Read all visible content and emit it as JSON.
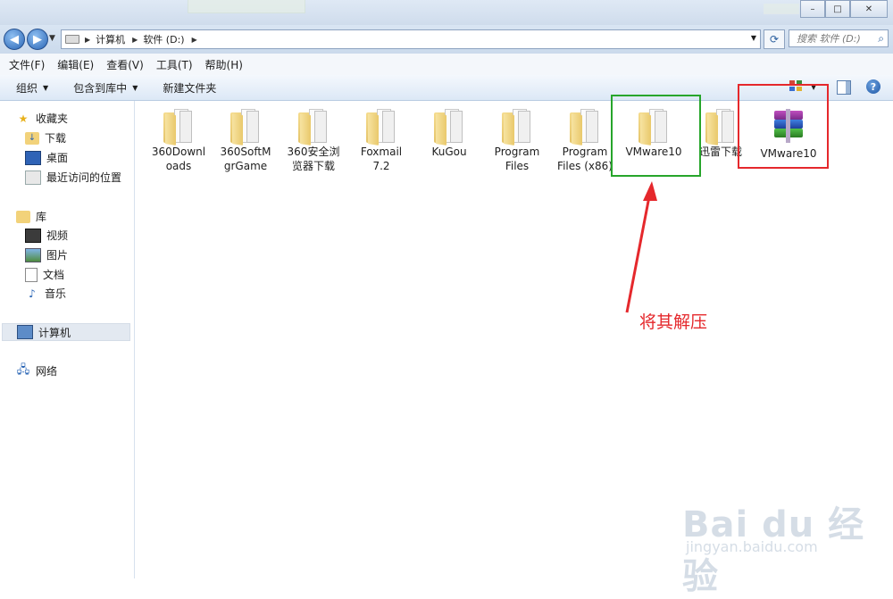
{
  "window": {
    "buttons": {
      "minimize": "–",
      "maximize": "□",
      "close": "✕"
    }
  },
  "address": {
    "segments": [
      "计算机",
      "软件 (D:)"
    ],
    "search_placeholder": "搜索 软件 (D:)"
  },
  "menu": [
    "文件(F)",
    "编辑(E)",
    "查看(V)",
    "工具(T)",
    "帮助(H)"
  ],
  "toolbar": {
    "organize": "组织",
    "include_in_library": "包含到库中",
    "new_folder": "新建文件夹"
  },
  "sidebar": {
    "favorites": {
      "label": "收藏夹",
      "icon": "star-icon",
      "items": [
        {
          "label": "下载",
          "icon": "download-folder-icon"
        },
        {
          "label": "桌面",
          "icon": "desktop-icon"
        },
        {
          "label": "最近访问的位置",
          "icon": "recent-places-icon"
        }
      ]
    },
    "libraries": {
      "label": "库",
      "icon": "library-icon",
      "items": [
        {
          "label": "视频",
          "icon": "video-icon"
        },
        {
          "label": "图片",
          "icon": "pictures-icon"
        },
        {
          "label": "文档",
          "icon": "documents-icon"
        },
        {
          "label": "音乐",
          "icon": "music-icon"
        }
      ]
    },
    "computer": {
      "label": "计算机",
      "icon": "computer-icon"
    },
    "network": {
      "label": "网络",
      "icon": "network-icon"
    }
  },
  "files": [
    {
      "name": "360Downloads",
      "lines": [
        "360Downl",
        "oads"
      ],
      "type": "folder"
    },
    {
      "name": "360SoftMgrGame",
      "lines": [
        "360SoftM",
        "grGame"
      ],
      "type": "folder"
    },
    {
      "name": "360安全浏览器下载",
      "lines": [
        "360安全浏",
        "览器下载"
      ],
      "type": "folder"
    },
    {
      "name": "Foxmail 7.2",
      "lines": [
        "Foxmail",
        "7.2"
      ],
      "type": "folder"
    },
    {
      "name": "KuGou",
      "lines": [
        "KuGou",
        ""
      ],
      "type": "folder"
    },
    {
      "name": "Program Files",
      "lines": [
        "Program",
        "Files"
      ],
      "type": "folder"
    },
    {
      "name": "Program Files (x86)",
      "lines": [
        "Program",
        "Files (x86)"
      ],
      "type": "folder"
    },
    {
      "name": "VMware10",
      "lines": [
        "VMware10",
        ""
      ],
      "type": "folder"
    },
    {
      "name": "迅雷下载",
      "lines": [
        "迅雷下载",
        ""
      ],
      "type": "folder"
    },
    {
      "name": "VMware10",
      "lines": [
        "VMware10",
        ""
      ],
      "type": "rar-archive"
    }
  ],
  "annotation": {
    "text": "将其解压",
    "green": "#27a52b",
    "red": "#e5282c"
  },
  "watermark": {
    "brand": "Bai du 经验",
    "url": "jingyan.baidu.com"
  }
}
